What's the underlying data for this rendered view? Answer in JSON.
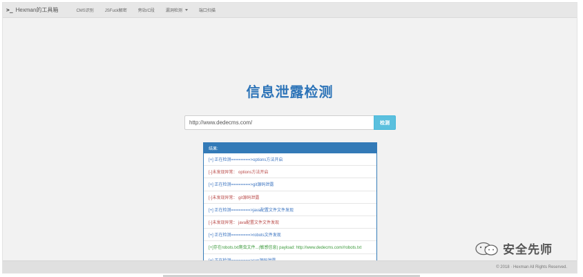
{
  "navbar": {
    "brand_icon": ">_",
    "brand": "Hexman的工具箱",
    "items": [
      {
        "label": "CMS识别",
        "dropdown": false
      },
      {
        "label": "JSFuck解密",
        "dropdown": false
      },
      {
        "label": "旁站/C段",
        "dropdown": false
      },
      {
        "label": "漏洞检测",
        "dropdown": true
      },
      {
        "label": "端口扫描",
        "dropdown": false
      }
    ]
  },
  "main": {
    "title": "信息泄露检测",
    "search": {
      "value": "http://www.dedecms.com/",
      "button_label": "检测"
    },
    "results": {
      "header": "结果:",
      "lines": [
        {
          "text": "[+] 正在检测========>options方法开启",
          "type": "info"
        },
        {
          "text": "[-]未发现异常： options方法开启",
          "type": "miss"
        },
        {
          "text": "[+] 正在检测========>git源码泄露",
          "type": "info"
        },
        {
          "text": "[-]未发现异常： git源码泄露",
          "type": "miss"
        },
        {
          "text": "[+] 正在检测========>java配置文件文件发现",
          "type": "info"
        },
        {
          "text": "[-]未发现异常： java配置文件文件发现",
          "type": "miss"
        },
        {
          "text": "[+] 正在检测========>robots文件发现",
          "type": "info"
        },
        {
          "text": "[+]存在robots.txt爬虫文件...(敏感信息) payload: http://www.dedecms.com//robots.txt",
          "type": "found"
        },
        {
          "text": "[+] 正在检测========>svn源码泄露",
          "type": "info"
        }
      ]
    }
  },
  "footer": {
    "text": "© 2018 · Hexman All Rights Reserved."
  },
  "watermark": {
    "text": "安全先师"
  },
  "colors": {
    "title": "#2d74b8",
    "panel_header": "#337ab7",
    "button": "#5bc0de",
    "info_text": "#3a73c0",
    "miss_text": "#b94a48",
    "found_text": "#3c9a3c"
  }
}
